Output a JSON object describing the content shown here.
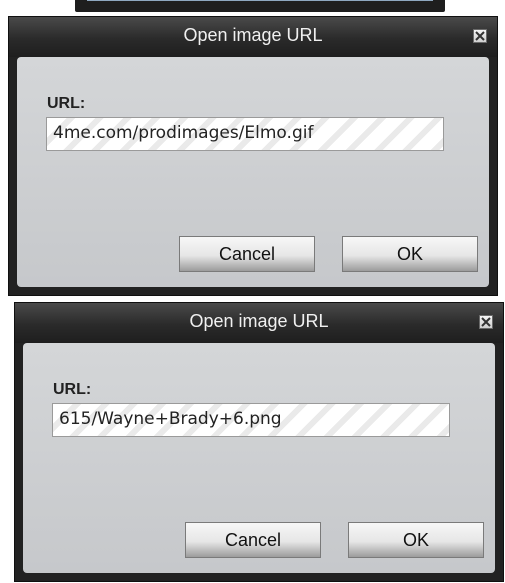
{
  "dialogs": [
    {
      "title": "Open image URL",
      "url_label": "URL:",
      "url_value": "4me.com/prodimages/Elmo.gif",
      "cancel_label": "Cancel",
      "ok_label": "OK"
    },
    {
      "title": "Open image URL",
      "url_label": "URL:",
      "url_value": "615/Wayne+Brady+6.png",
      "cancel_label": "Cancel",
      "ok_label": "OK"
    }
  ],
  "icons": {
    "close": "close-icon"
  }
}
